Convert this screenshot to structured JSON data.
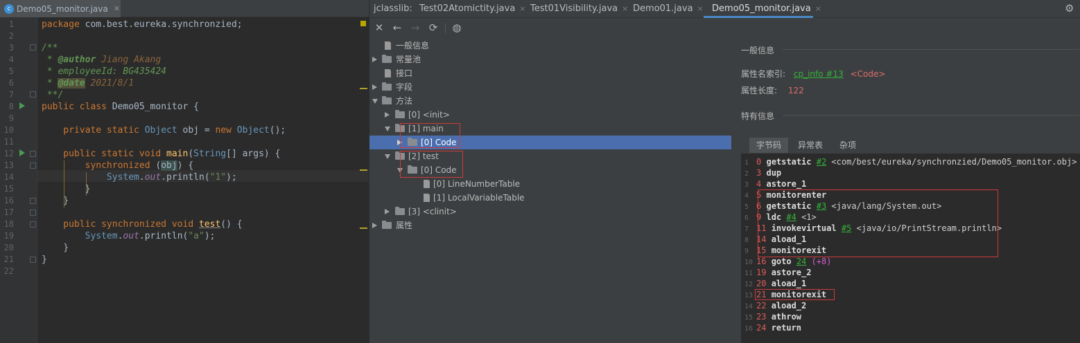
{
  "editor": {
    "tab": {
      "label": "Demo05_monitor.java",
      "icon": "c-class-icon"
    },
    "lines": [
      "1",
      "2",
      "3",
      "4",
      "5",
      "6",
      "7",
      "8",
      "9",
      "10",
      "11",
      "12",
      "13",
      "14",
      "15",
      "16",
      "17",
      "18",
      "19",
      "20",
      "21",
      "22"
    ],
    "code": {
      "l1_kw": "package",
      "l1_rest": " com.best.eureka.synchronzied;",
      "l3": "/**",
      "l4_pre": " * ",
      "l4_tag": "@author",
      "l4_val": " Jiang Akang",
      "l5": " * employeeId: BG435424",
      "l6_pre": " * ",
      "l6_tag": "@date",
      "l6_val": " 2021/8/1",
      "l7": " **/",
      "l8_kw": "public class ",
      "l8_name": "Demo05_monitor {",
      "l10_kw": "    private static ",
      "l10_typ": "Object",
      "l10_a": " obj = ",
      "l10_kw2": "new ",
      "l10_typ2": "Object",
      "l10_b": "();",
      "l12_kw": "    public static void ",
      "l12_fn": "main",
      "l12_a": "(",
      "l12_typ": "String",
      "l12_b": "[] args) {",
      "l13_kw": "        synchronized ",
      "l13_a": "(",
      "l13_obj": "obj",
      "l13_b": ") {",
      "l14_pre": "            ",
      "l14_sys": "System",
      "l14_dot": ".",
      "l14_out": "out",
      "l14_call": ".println(",
      "l14_str": "\"1\"",
      "l14_end": ");",
      "l15": "        }",
      "l16": "    }",
      "l18_kw": "    public synchronized void ",
      "l18_fn": "test",
      "l18_end": "() {",
      "l19_pre": "        ",
      "l19_sys": "System",
      "l19_dot": ".",
      "l19_out": "out",
      "l19_call": ".println(",
      "l19_str": "\"a\"",
      "l19_end": ");",
      "l20": "    }",
      "l21": "}"
    }
  },
  "jclasslib": {
    "label": "jclasslib:",
    "tabs": [
      {
        "label": "Test02Atomictity.java",
        "close": "×"
      },
      {
        "label": "Test01Visibility.java",
        "close": "×"
      },
      {
        "label": "Demo01.java",
        "close": "×"
      },
      {
        "label": "Demo05_monitor.java",
        "close": "×",
        "active": true
      }
    ],
    "toolbar": [
      "close-icon",
      "back-icon",
      "forward-icon",
      "refresh-icon",
      "browser-icon"
    ],
    "tree": [
      {
        "label": "一般信息"
      },
      {
        "label": "常量池"
      },
      {
        "label": "接口"
      },
      {
        "label": "字段"
      },
      {
        "label": "方法"
      },
      {
        "label": "[0] <init>"
      },
      {
        "label": "[1] main"
      },
      {
        "label": "[0] Code",
        "selected": true
      },
      {
        "label": "[2] test"
      },
      {
        "label": "[0] Code"
      },
      {
        "label": "[0] LineNumberTable"
      },
      {
        "label": "[1] LocalVariableTable"
      },
      {
        "label": "[3] <clinit>"
      },
      {
        "label": "属性"
      }
    ],
    "general": {
      "title": "一般信息",
      "name_index_label": "属性名索引:",
      "name_index_link": "cp_info #13",
      "name_index_value": "<Code>",
      "length_label": "属性长度:",
      "length_value": "122"
    },
    "specific_title": "特有信息",
    "subtabs": [
      "字节码",
      "异常表",
      "杂项"
    ],
    "bytecode": [
      {
        "n": "1",
        "off": "0",
        "op": "getstatic",
        "ref": "#2",
        "arg": "<com/best/eureka/synchronzied/Demo05_monitor.obj>"
      },
      {
        "n": "2",
        "off": "3",
        "op": "dup"
      },
      {
        "n": "3",
        "off": "4",
        "op": "astore_1"
      },
      {
        "n": "4",
        "off": "5",
        "op": "monitorenter"
      },
      {
        "n": "5",
        "off": "6",
        "op": "getstatic",
        "ref": "#3",
        "arg": "<java/lang/System.out>"
      },
      {
        "n": "6",
        "off": "9",
        "op": "ldc",
        "ref": "#4",
        "arg": "<1>"
      },
      {
        "n": "7",
        "off": "11",
        "op": "invokevirtual",
        "ref": "#5",
        "arg": "<java/io/PrintStream.println>"
      },
      {
        "n": "8",
        "off": "14",
        "op": "aload_1"
      },
      {
        "n": "9",
        "off": "15",
        "op": "monitorexit"
      },
      {
        "n": "10",
        "off": "16",
        "op": "goto",
        "ref": "24",
        "extra": "(+8)"
      },
      {
        "n": "11",
        "off": "19",
        "op": "astore_2"
      },
      {
        "n": "12",
        "off": "20",
        "op": "aload_1"
      },
      {
        "n": "13",
        "off": "21",
        "op": "monitorexit"
      },
      {
        "n": "14",
        "off": "22",
        "op": "aload_2"
      },
      {
        "n": "15",
        "off": "23",
        "op": "athrow"
      },
      {
        "n": "16",
        "off": "24",
        "op": "return"
      }
    ]
  }
}
